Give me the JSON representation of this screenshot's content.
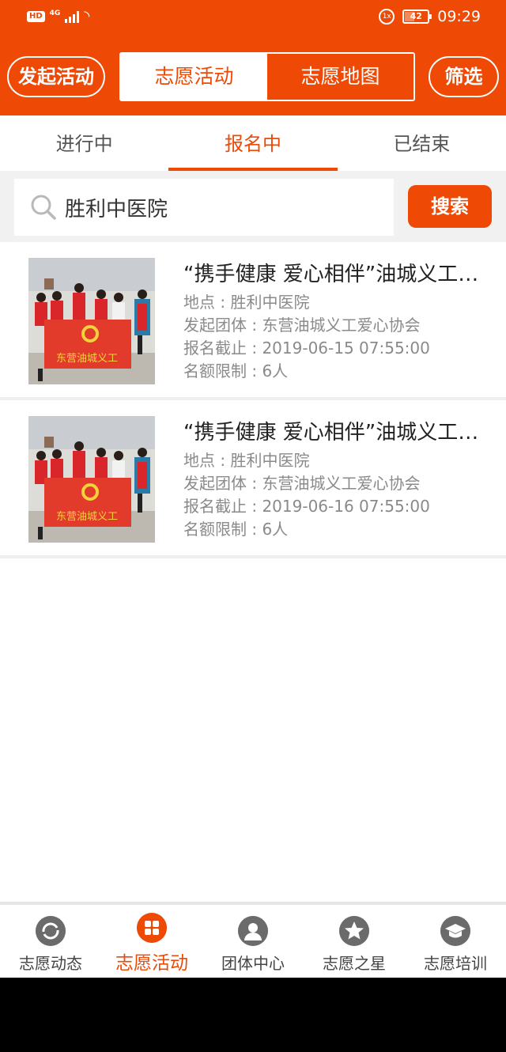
{
  "status_bar": {
    "hd": "HD",
    "network": "4G",
    "vibrate": "1x",
    "battery": "42",
    "battery_level": 0.42,
    "time": "09:29"
  },
  "header": {
    "launch_label": "发起活动",
    "segments": [
      "志愿活动",
      "志愿地图"
    ],
    "active_segment": 0,
    "filter_label": "筛选"
  },
  "status_tabs": {
    "items": [
      "进行中",
      "报名中",
      "已结束"
    ],
    "active": 1
  },
  "search": {
    "value": "胜利中医院",
    "button_label": "搜索"
  },
  "activities": [
    {
      "title": "“携手健康 爱心相伴”油城义工爱心协会志愿服务活动",
      "location": "地点 : 胜利中医院",
      "organizer": "发起团体 : 东营油城义工爱心协会",
      "deadline": "报名截止 : 2019-06-15 07:55:00",
      "quota": "名额限制 : 6人",
      "banner_text": "东营油城义工"
    },
    {
      "title": "“携手健康 爱心相伴”油城义工爱心协会志愿服务活动",
      "location": "地点 : 胜利中医院",
      "organizer": "发起团体 : 东营油城义工爱心协会",
      "deadline": "报名截止 : 2019-06-16 07:55:00",
      "quota": "名额限制 : 6人",
      "banner_text": "东营油城义工"
    }
  ],
  "bottom_nav": {
    "items": [
      {
        "label": "志愿动态",
        "icon": "refresh-icon"
      },
      {
        "label": "志愿活动",
        "icon": "grid-icon"
      },
      {
        "label": "团体中心",
        "icon": "person-icon"
      },
      {
        "label": "志愿之星",
        "icon": "star-icon"
      },
      {
        "label": "志愿培训",
        "icon": "graduation-cap-icon"
      }
    ],
    "active": 1
  },
  "colors": {
    "brand": "#ee4a06",
    "icon_inactive": "#6b6b6b"
  }
}
